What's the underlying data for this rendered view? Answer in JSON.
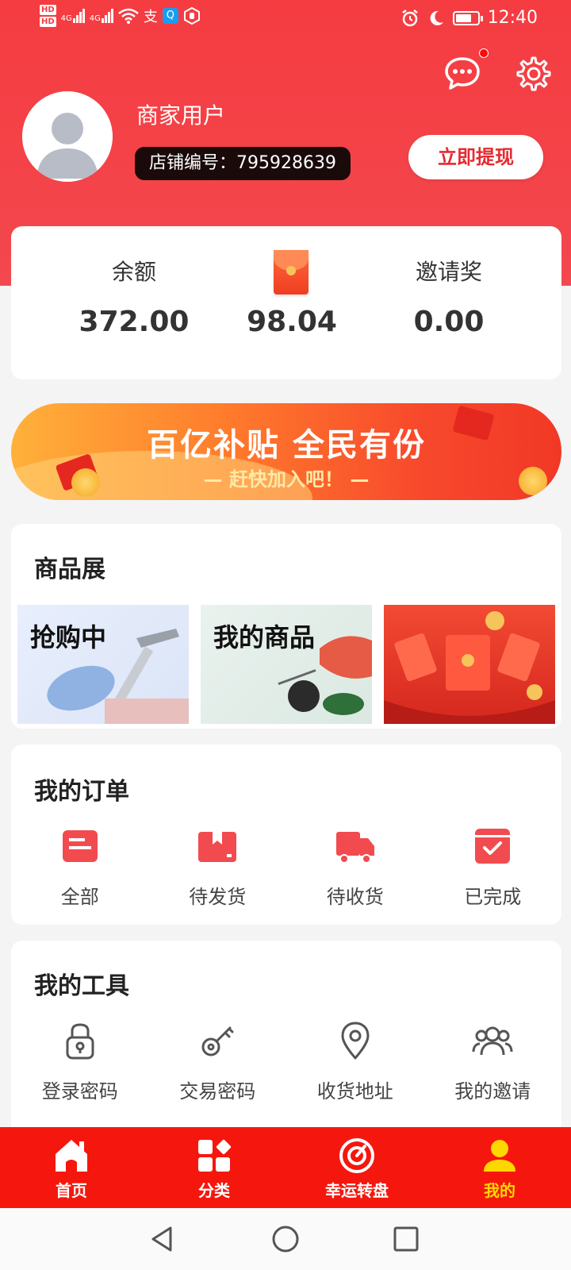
{
  "status_bar": {
    "time": "12:40",
    "hd1": "HD",
    "hd2": "HD",
    "net1": "4G",
    "net2": "4G"
  },
  "profile": {
    "username": "商家用户",
    "store_id_label": "店铺编号：",
    "store_id": "795928639",
    "withdraw_label": "立即提现"
  },
  "stats": {
    "balance_label": "余额",
    "balance_value": "372.00",
    "red_packet_value": "98.04",
    "invite_label": "邀请奖",
    "invite_value": "0.00"
  },
  "banner": {
    "title": "百亿补贴 全民有份",
    "subtitle": "— 赶快加入吧！ —"
  },
  "products": {
    "title": "商品展",
    "tiles": [
      "抢购中",
      "我的商品"
    ]
  },
  "orders": {
    "title": "我的订单",
    "items": [
      {
        "label": "全部",
        "icon": "all-orders-icon"
      },
      {
        "label": "待发货",
        "icon": "pending-shipment-icon"
      },
      {
        "label": "待收货",
        "icon": "pending-receipt-icon"
      },
      {
        "label": "已完成",
        "icon": "completed-icon"
      }
    ]
  },
  "tools": {
    "title": "我的工具",
    "items": [
      {
        "label": "登录密码",
        "icon": "lock-icon"
      },
      {
        "label": "交易密码",
        "icon": "key-icon"
      },
      {
        "label": "收货地址",
        "icon": "location-pin-icon"
      },
      {
        "label": "我的邀请",
        "icon": "users-icon"
      }
    ]
  },
  "nav": {
    "items": [
      {
        "label": "首页",
        "icon": "home-icon"
      },
      {
        "label": "分类",
        "icon": "category-icon"
      },
      {
        "label": "幸运转盘",
        "icon": "lucky-wheel-icon"
      },
      {
        "label": "我的",
        "icon": "user-icon"
      }
    ],
    "active_index": 3
  },
  "colors": {
    "brand_red": "#f43c41",
    "nav_red": "#f5170e",
    "accent_gold": "#ffd700",
    "icon_red": "#f24b4f"
  }
}
